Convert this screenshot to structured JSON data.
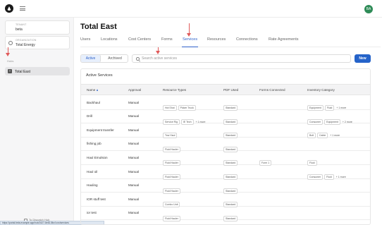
{
  "header": {
    "user_initials": "BA"
  },
  "sidebar": {
    "tenant": {
      "caption": "TENANT",
      "value": "beta"
    },
    "organization": {
      "caption": "ORGANIZATION",
      "value": "Total Energy"
    },
    "hubs_label": "Hubs",
    "hub": {
      "badge": "T",
      "name": "Total East"
    },
    "footer_link": "To Dispatch Hub"
  },
  "status_bar": "https://portal.beta.example.app/hub/2427-8e52-8bcf-xxx/services",
  "main": {
    "title": "Total East",
    "tabs": [
      "Users",
      "Locations",
      "Cost Centers",
      "Forms",
      "Services",
      "Resources",
      "Connections",
      "Rate Agreements"
    ],
    "active_tab": "Services",
    "filter": {
      "active": "Active",
      "archived": "Archived"
    },
    "search_placeholder": "Search active services",
    "new_button": "New",
    "panel_title": "Active Services",
    "columns": [
      "Name",
      "Approval",
      "Resource Types",
      "PDF Used",
      "Forms Connected",
      "Inventory Category"
    ],
    "rows": [
      {
        "name": "Backhaul",
        "approval": "Manual",
        "resources": [
          "Hot Shot",
          "Picker Truck"
        ],
        "resources_more": "",
        "pdf": "Standard",
        "forms": "",
        "inventory": [
          "Equipment",
          "Fluid"
        ],
        "inventory_more": "+ 1 more"
      },
      {
        "name": "Drill",
        "approval": "Manual",
        "resources": [
          "Service Rig",
          "IE Tech"
        ],
        "resources_more": "+ 1 more",
        "pdf": "Standard",
        "forms": "",
        "inventory": [
          "Consumer",
          "Equipment"
        ],
        "inventory_more": "+ 2 more"
      },
      {
        "name": "Equipment transfer",
        "approval": "Manual",
        "resources": [
          "Tow Haul"
        ],
        "resources_more": "",
        "pdf": "Standard",
        "forms": "",
        "inventory": [
          "Bolt",
          "Cable"
        ],
        "inventory_more": "+ 1 more"
      },
      {
        "name": "fishing job",
        "approval": "Manual",
        "resources": [
          "Fluid Hauler"
        ],
        "resources_more": "",
        "pdf": "Standard",
        "forms": "",
        "inventory": [],
        "inventory_more": ""
      },
      {
        "name": "Haul Emulsion",
        "approval": "Manual",
        "resources": [
          "Fluid Hauler"
        ],
        "resources_more": "",
        "pdf": "Standard",
        "forms": "Form 1",
        "inventory": [
          "Fluid"
        ],
        "inventory_more": ""
      },
      {
        "name": "Haul oil",
        "approval": "Manual",
        "resources": [
          "Fluid Hauler"
        ],
        "resources_more": "",
        "pdf": "Standard",
        "forms": "",
        "inventory": [
          "Consumer",
          "Fluid"
        ],
        "inventory_more": "+ 1 more"
      },
      {
        "name": "Hauling",
        "approval": "Manual",
        "resources": [
          "Fluid Hauler"
        ],
        "resources_more": "",
        "pdf": "Standard",
        "forms": "",
        "inventory": [],
        "inventory_more": ""
      },
      {
        "name": "IOR stuff test",
        "approval": "Manual",
        "resources": [
          "Combo Unit"
        ],
        "resources_more": "",
        "pdf": "Standard",
        "forms": "",
        "inventory": [],
        "inventory_more": ""
      },
      {
        "name": "ior test",
        "approval": "Manual",
        "resources": [
          "Fluid Hauler"
        ],
        "resources_more": "",
        "pdf": "Standard",
        "forms": "",
        "inventory": [],
        "inventory_more": ""
      }
    ]
  },
  "colors": {
    "accent": "#2563c9",
    "annotation_arrow": "#e05a5a",
    "avatar": "#2e8b57"
  }
}
